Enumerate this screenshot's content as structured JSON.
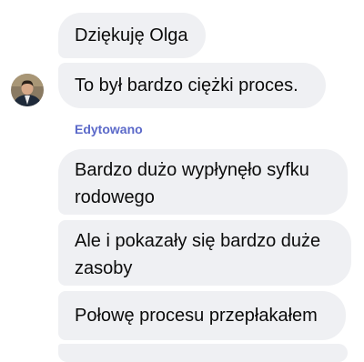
{
  "messages": [
    "Dziękuję Olga",
    "To był bardzo ciężki proces.",
    "Bardzo dużo wypłynęło syfku rodowego",
    "Ale i pokazały się bardzo duże zasoby",
    "Połowę procesu przepłakałem"
  ],
  "edited_label": "Edytowano",
  "colors": {
    "bubble_background": "#eff0f3",
    "edited_text": "#5b69c9",
    "message_text": "#0b0b0b"
  }
}
